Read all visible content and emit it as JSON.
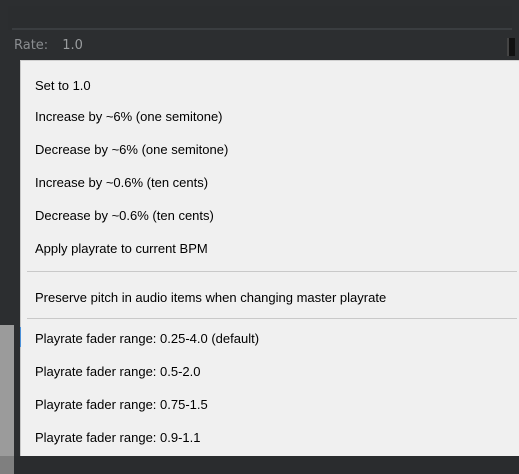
{
  "header": {
    "rate_label": "Rate:",
    "rate_value": "1.0"
  },
  "menu": {
    "group1": [
      "Set to 1.0",
      "Increase by ~6% (one semitone)",
      "Decrease by ~6% (one semitone)",
      "Increase by ~0.6% (ten cents)",
      "Decrease by ~0.6% (ten cents)",
      "Apply playrate to current BPM"
    ],
    "group2": [
      "Preserve pitch in audio items when changing master playrate"
    ],
    "group3": [
      "Playrate fader range: 0.25-4.0 (default)",
      "Playrate fader range: 0.5-2.0",
      "Playrate fader range: 0.75-1.5",
      "Playrate fader range: 0.9-1.1"
    ]
  }
}
